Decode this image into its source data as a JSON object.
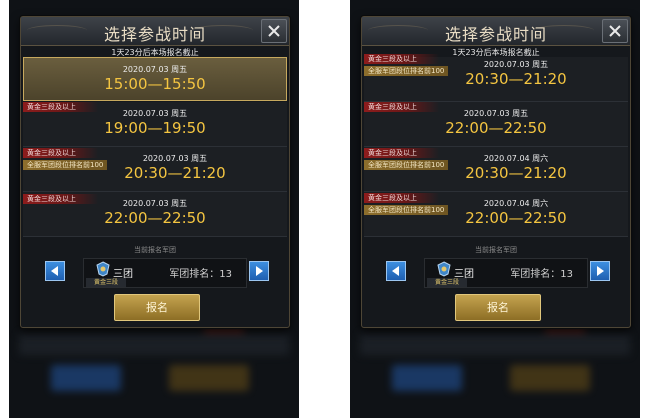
{
  "screens": [
    {
      "title": "选择参战时间",
      "notice": "1天23分后本场报名截止",
      "slots": [
        {
          "date": "2020.07.03 周五",
          "time": "15:00—15:50",
          "tags": [],
          "selected": true
        },
        {
          "date": "2020.07.03 周五",
          "time": "19:00—19:50",
          "tags": [
            "黄金三段及以上"
          ],
          "selected": false
        },
        {
          "date": "2020.07.03 周五",
          "time": "20:30—21:20",
          "tags": [
            "黄金三段及以上",
            "全服军团段位排名前100"
          ],
          "selected": false
        },
        {
          "date": "2020.07.03 周五",
          "time": "22:00—22:50",
          "tags": [
            "黄金三段及以上"
          ],
          "selected": false
        }
      ],
      "registered_label": "当前报名军团",
      "legion": {
        "name": "三团",
        "rank_badge": "黄金三段",
        "rank_text": "军团排名：13"
      },
      "signup_label": "报名"
    },
    {
      "title": "选择参战时间",
      "notice": "1天23分后本场报名截止",
      "slots": [
        {
          "date": "2020.07.03 周五",
          "time": "20:30—21:20",
          "tags": [
            "黄金三段及以上",
            "全服军团段位排名前100"
          ],
          "selected": false
        },
        {
          "date": "2020.07.03 周五",
          "time": "22:00—22:50",
          "tags": [
            "黄金三段及以上"
          ],
          "selected": false
        },
        {
          "date": "2020.07.04 周六",
          "time": "20:30—21:20",
          "tags": [
            "黄金三段及以上",
            "全服军团段位排名前100"
          ],
          "selected": false
        },
        {
          "date": "2020.07.04 周六",
          "time": "22:00—22:50",
          "tags": [
            "黄金三段及以上",
            "全服军团段位排名前100"
          ],
          "selected": false
        }
      ],
      "registered_label": "当前报名军团",
      "legion": {
        "name": "三团",
        "rank_badge": "黄金三段",
        "rank_text": "军团排名：13"
      },
      "signup_label": "报名"
    }
  ],
  "icons": {
    "close": "close-icon",
    "prev": "arrow-left-icon",
    "next": "arrow-right-icon",
    "emblem": "legion-emblem-icon"
  },
  "colors": {
    "time": "#f4c541",
    "tag_red": "#8d1c1c",
    "tag_gold": "#8d6e2c",
    "arrow_blue": "#2f78cc",
    "signup_gold": "#b08f3f"
  }
}
